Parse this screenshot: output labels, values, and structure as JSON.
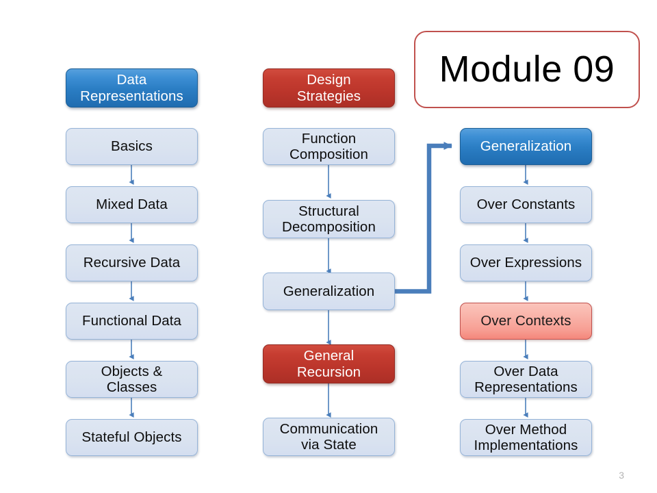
{
  "slide": {
    "title": "Module 09",
    "page_number": "3",
    "background_color": "#ffffff"
  },
  "colors": {
    "box_light_blue_fill": "#dae3f0",
    "box_light_blue_border": "#95b3d7",
    "header_blue_fill": "#2b7ec4",
    "header_blue_border": "#1b5e96",
    "header_red_fill": "#bb352b",
    "header_red_border": "#932a22",
    "highlight_pink_fill": "#f9b4aa",
    "highlight_pink_border": "#c0504d",
    "title_border": "#c0504d",
    "thin_arrow": "#4a7ebb",
    "thick_arrow": "#4a7ebb",
    "text_dark": "#0d0d0d",
    "text_light": "#ffffff",
    "page_number": "#b4b4b4"
  },
  "columns": [
    {
      "id": "data-representations",
      "header": {
        "label": "Data\nRepresentations",
        "style": "blue"
      },
      "items": [
        {
          "label": "Basics",
          "style": "plain"
        },
        {
          "label": "Mixed Data",
          "style": "plain"
        },
        {
          "label": "Recursive Data",
          "style": "plain"
        },
        {
          "label": "Functional Data",
          "style": "plain"
        },
        {
          "label": "Objects &\nClasses",
          "style": "plain"
        },
        {
          "label": "Stateful Objects",
          "style": "plain"
        }
      ]
    },
    {
      "id": "design-strategies",
      "header": {
        "label": "Design\nStrategies",
        "style": "red"
      },
      "items": [
        {
          "label": "Function\nComposition",
          "style": "plain"
        },
        {
          "label": "Structural\nDecomposition",
          "style": "plain"
        },
        {
          "label": "Generalization",
          "style": "plain"
        },
        {
          "label": "General\nRecursion",
          "style": "red"
        },
        {
          "label": "Communication\nvia State",
          "style": "plain"
        }
      ]
    },
    {
      "id": "generalization-detail",
      "header": {
        "label": "Generalization",
        "style": "blue"
      },
      "items": [
        {
          "label": "Over Constants",
          "style": "plain"
        },
        {
          "label": "Over Expressions",
          "style": "plain"
        },
        {
          "label": "Over Contexts",
          "style": "pink"
        },
        {
          "label": "Over Data\nRepresentations",
          "style": "plain"
        },
        {
          "label": "Over Method\nImplementations",
          "style": "plain"
        }
      ]
    }
  ]
}
